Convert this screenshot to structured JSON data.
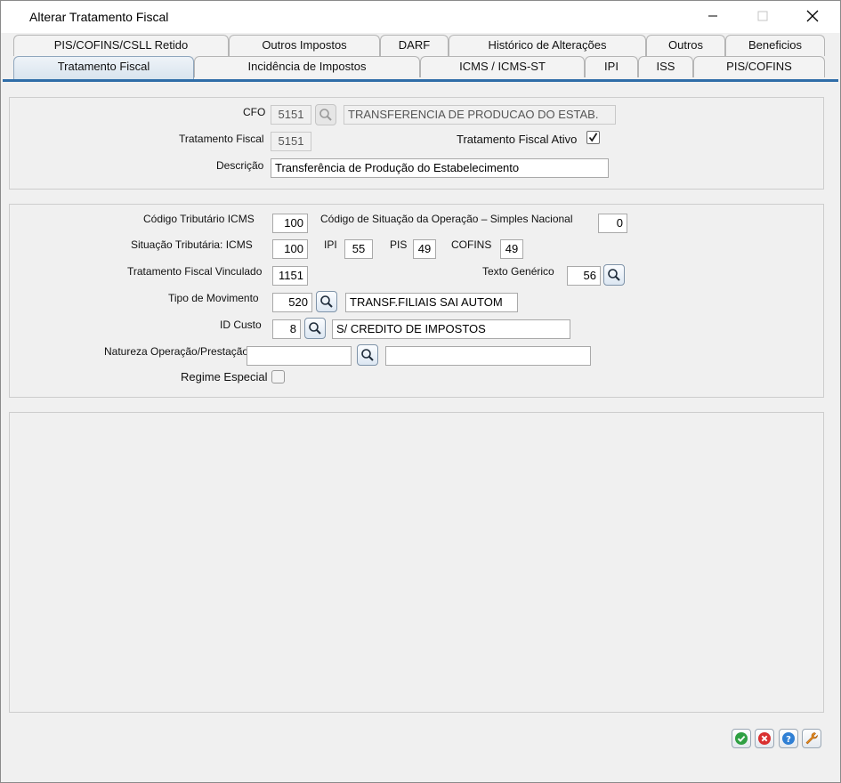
{
  "window": {
    "title": "Alterar Tratamento Fiscal"
  },
  "tabs_row1": [
    {
      "label": "PIS/COFINS/CSLL Retido"
    },
    {
      "label": "Outros Impostos"
    },
    {
      "label": "DARF"
    },
    {
      "label": "Histórico de Alterações"
    },
    {
      "label": "Outros"
    },
    {
      "label": "Beneficios"
    }
  ],
  "tabs_row2": [
    {
      "label": "Tratamento Fiscal",
      "active": true
    },
    {
      "label": "Incidência de Impostos"
    },
    {
      "label": "ICMS / ICMS-ST"
    },
    {
      "label": "IPI"
    },
    {
      "label": "ISS"
    },
    {
      "label": "PIS/COFINS"
    }
  ],
  "header_panel": {
    "cfo_label": "CFO",
    "cfo_value": "5151",
    "cfo_description": "TRANSFERENCIA DE PRODUCAO DO ESTAB.",
    "tratamento_label": "Tratamento Fiscal",
    "tratamento_value": "5151",
    "ativo_label": "Tratamento Fiscal Ativo",
    "ativo_checked": true,
    "descricao_label": "Descrição",
    "descricao_value": "Transferência de Produção do Estabelecimento"
  },
  "detail_panel": {
    "cod_trib_icms_label": "Código Tributário ICMS",
    "cod_trib_icms_value": "100",
    "cod_sit_label": "Código de Situação da Operação – Simples Nacional",
    "cod_sit_value": "0",
    "sit_trib_label": "Situação Tributária: ICMS",
    "sit_trib_value": "100",
    "ipi_label": "IPI",
    "ipi_value": "55",
    "pis_label": "PIS",
    "pis_value": "49",
    "cofins_label": "COFINS",
    "cofins_value": "49",
    "trat_vinc_label": "Tratamento Fiscal Vinculado",
    "trat_vinc_value": "1151",
    "texto_gen_label": "Texto Genérico",
    "texto_gen_value": "56",
    "tipo_mov_label": "Tipo de Movimento",
    "tipo_mov_value": "520",
    "tipo_mov_desc": "TRANSF.FILIAIS SAI AUTOM",
    "id_custo_label": "ID Custo",
    "id_custo_value": "8",
    "id_custo_desc": "S/ CREDITO DE IMPOSTOS",
    "natureza_label": "Natureza Operação/Prestação",
    "natureza_value": "",
    "natureza_desc": "",
    "regime_label": "Regime Especial",
    "regime_checked": false
  },
  "icons": {
    "search": "magnifier-icon",
    "confirm": "check-circle-icon",
    "cancel": "x-circle-icon",
    "help": "question-circle-icon",
    "tools": "wrench-icon"
  },
  "colors": {
    "accent": "#2f6da8",
    "confirm": "#2fa043",
    "cancel": "#d93030",
    "help": "#2f7fd4",
    "tools": "#e58a1f"
  }
}
